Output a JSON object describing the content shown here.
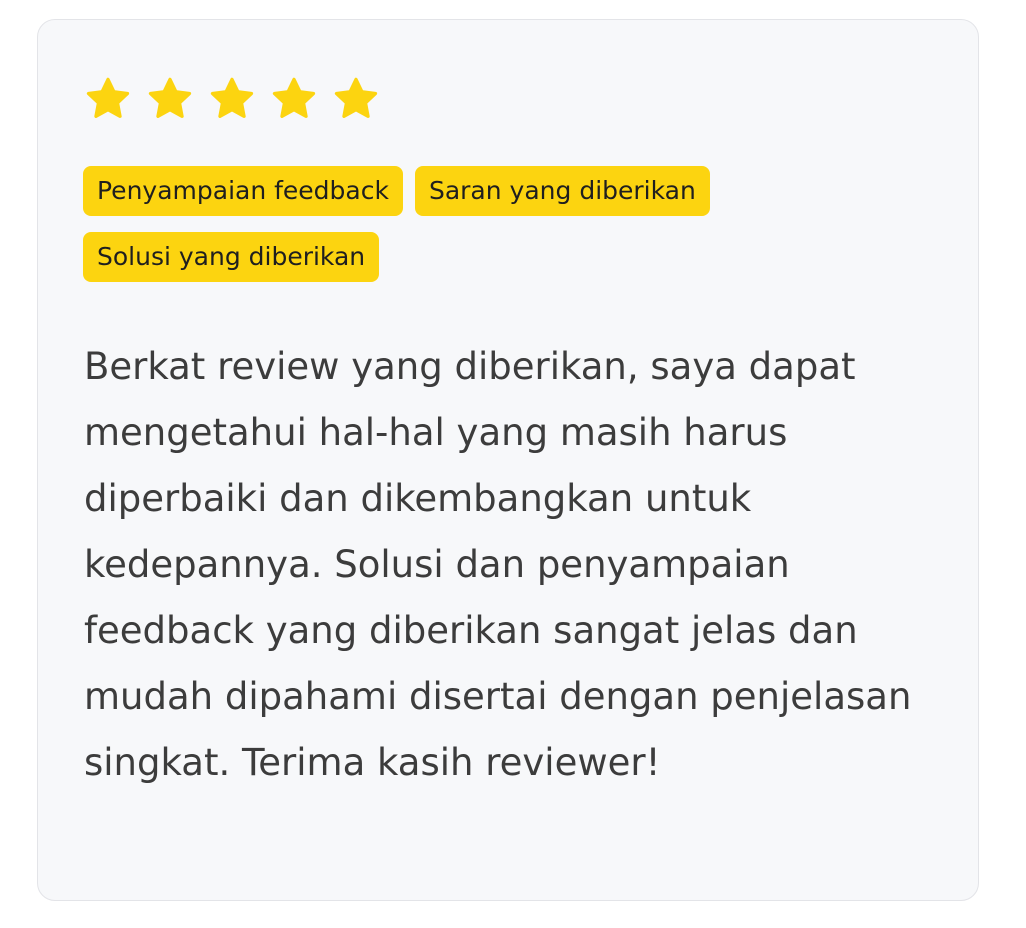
{
  "rating": {
    "value": 5,
    "max": 5,
    "star_color": "#FCD410",
    "icon": "star-icon"
  },
  "tags": [
    "Penyampaian feedback",
    "Saran yang diberikan",
    "Solusi yang diberikan"
  ],
  "tag_color": "#FCD410",
  "review_text": "Berkat review yang diberikan, saya dapat mengetahui hal-hal yang masih harus diperbaiki dan dikembangkan untuk kedepannya. Solusi dan penyampaian feedback yang diberikan sangat jelas dan mudah dipahami disertai dengan penjelasan singkat. Terima kasih reviewer!"
}
